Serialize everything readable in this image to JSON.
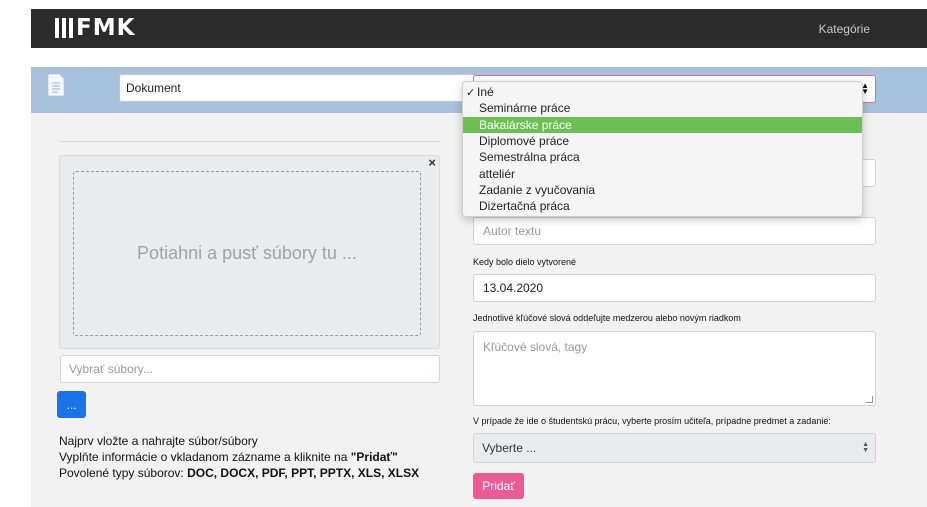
{
  "navbar": {
    "logo": "FMK",
    "link": "Kategórie"
  },
  "toolbar": {
    "icon": "document-icon",
    "type_select": "Dokument",
    "category_select": "Iné"
  },
  "dropdown": {
    "items": [
      {
        "label": "Iné",
        "checked": true,
        "highlighted": false
      },
      {
        "label": "Seminárne práce",
        "checked": false,
        "highlighted": false
      },
      {
        "label": "Bakalárske práce",
        "checked": false,
        "highlighted": true
      },
      {
        "label": "Diplomové práce",
        "checked": false,
        "highlighted": false
      },
      {
        "label": "Semestrálna práca",
        "checked": false,
        "highlighted": false
      },
      {
        "label": "atteliér",
        "checked": false,
        "highlighted": false
      },
      {
        "label": "Zadanie z vyučovania",
        "checked": false,
        "highlighted": false
      },
      {
        "label": "Dizertačná práca",
        "checked": false,
        "highlighted": false
      }
    ],
    "highlight_color": "#6cbf55"
  },
  "upload": {
    "close": "×",
    "dropzone_text": "Potiahni a pusť súbory tu ...",
    "file_placeholder": "Vybrať súbory...",
    "browse_label": "...",
    "instructions": {
      "line1": "Najprv vložte a nahrajte súbor/súbory",
      "line2_prefix": "Vyplňte informácie o vkladanom zázname a kliknite na ",
      "line2_action": "\"Pridať\"",
      "line3_prefix": "Povolené typy súborov: ",
      "line3_types": "DOC, DOCX, PDF, PPT, PPTX, XLS, XLSX"
    }
  },
  "form": {
    "author_placeholder": "Autor textu",
    "date_label": "Kedy bolo dielo vytvorené",
    "date_value": "13.04.2020",
    "keywords_label": "Jednotlivé kľúčové slová oddeľujte medzerou alebo novým riadkom",
    "keywords_placeholder": "Kľúčové slová, tagy",
    "teacher_label": "V prípade že ide o študentskú prácu, vyberte prosím učiteľa, prípadne predmet a zadanie:",
    "teacher_select": "Vyberte ...",
    "submit_label": "Pridať"
  },
  "colors": {
    "navbar": "#2b2b2b",
    "toolbar": "#a8c1dc",
    "accent_pink": "#ea5b93",
    "browse_blue": "#1a73e8"
  }
}
